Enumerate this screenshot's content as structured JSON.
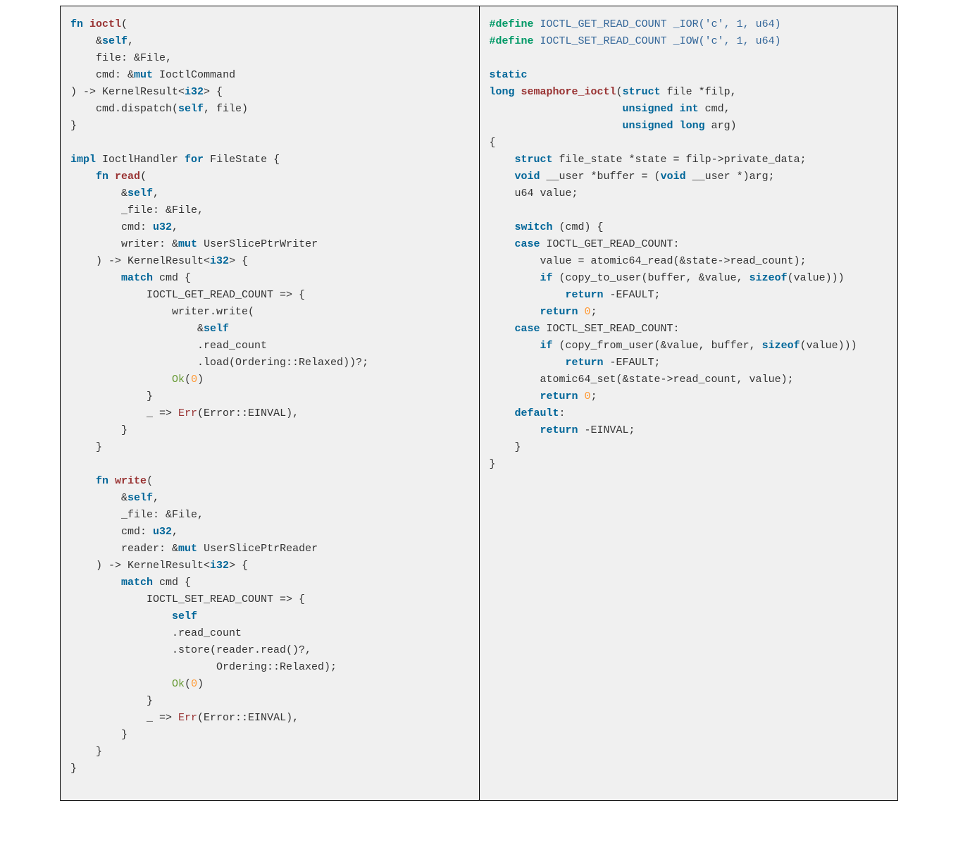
{
  "left": {
    "lang": "rust",
    "tokens": [
      [
        "kw",
        "fn"
      ],
      [
        "p",
        " "
      ],
      [
        "fnname",
        "ioctl"
      ],
      [
        "p",
        "("
      ],
      [
        "nl"
      ],
      [
        "p",
        "    "
      ],
      [
        "p",
        "&"
      ],
      [
        "kw",
        "self"
      ],
      [
        "p",
        ","
      ],
      [
        "nl"
      ],
      [
        "p",
        "    file: "
      ],
      [
        "p",
        "&File,"
      ],
      [
        "nl"
      ],
      [
        "p",
        "    cmd: "
      ],
      [
        "p",
        "&"
      ],
      [
        "kw",
        "mut"
      ],
      [
        "p",
        " IoctlCommand"
      ],
      [
        "nl"
      ],
      [
        "p",
        ") -> KernelResult<"
      ],
      [
        "ty",
        "i32"
      ],
      [
        "p",
        "> {"
      ],
      [
        "nl"
      ],
      [
        "p",
        "    cmd.dispatch("
      ],
      [
        "kw",
        "self"
      ],
      [
        "p",
        ", file)"
      ],
      [
        "nl"
      ],
      [
        "p",
        "}"
      ],
      [
        "nl"
      ],
      [
        "nl"
      ],
      [
        "kw",
        "impl"
      ],
      [
        "p",
        " IoctlHandler "
      ],
      [
        "kw",
        "for"
      ],
      [
        "p",
        " FileState {"
      ],
      [
        "nl"
      ],
      [
        "p",
        "    "
      ],
      [
        "kw",
        "fn"
      ],
      [
        "p",
        " "
      ],
      [
        "fnname",
        "read"
      ],
      [
        "p",
        "("
      ],
      [
        "nl"
      ],
      [
        "p",
        "        "
      ],
      [
        "p",
        "&"
      ],
      [
        "kw",
        "self"
      ],
      [
        "p",
        ","
      ],
      [
        "nl"
      ],
      [
        "p",
        "        _file: "
      ],
      [
        "p",
        "&File,"
      ],
      [
        "nl"
      ],
      [
        "p",
        "        cmd: "
      ],
      [
        "ty",
        "u32"
      ],
      [
        "p",
        ","
      ],
      [
        "nl"
      ],
      [
        "p",
        "        writer: "
      ],
      [
        "p",
        "&"
      ],
      [
        "kw",
        "mut"
      ],
      [
        "p",
        " UserSlicePtrWriter"
      ],
      [
        "nl"
      ],
      [
        "p",
        "    ) -> KernelResult<"
      ],
      [
        "ty",
        "i32"
      ],
      [
        "p",
        "> {"
      ],
      [
        "nl"
      ],
      [
        "p",
        "        "
      ],
      [
        "kw",
        "match"
      ],
      [
        "p",
        " cmd {"
      ],
      [
        "nl"
      ],
      [
        "p",
        "            IOCTL_GET_READ_COUNT => {"
      ],
      [
        "nl"
      ],
      [
        "p",
        "                writer.write("
      ],
      [
        "nl"
      ],
      [
        "p",
        "                    &"
      ],
      [
        "kw",
        "self"
      ],
      [
        "nl"
      ],
      [
        "p",
        "                    .read_count"
      ],
      [
        "nl"
      ],
      [
        "p",
        "                    .load(Ordering::Relaxed))?;"
      ],
      [
        "nl"
      ],
      [
        "p",
        "                "
      ],
      [
        "ok",
        "Ok"
      ],
      [
        "p",
        "("
      ],
      [
        "n",
        "0"
      ],
      [
        "p",
        ")"
      ],
      [
        "nl"
      ],
      [
        "p",
        "            }"
      ],
      [
        "nl"
      ],
      [
        "p",
        "            _ => "
      ],
      [
        "err",
        "Err"
      ],
      [
        "p",
        "(Error::EINVAL),"
      ],
      [
        "nl"
      ],
      [
        "p",
        "        }"
      ],
      [
        "nl"
      ],
      [
        "p",
        "    }"
      ],
      [
        "nl"
      ],
      [
        "nl"
      ],
      [
        "p",
        "    "
      ],
      [
        "kw",
        "fn"
      ],
      [
        "p",
        " "
      ],
      [
        "fnname",
        "write"
      ],
      [
        "p",
        "("
      ],
      [
        "nl"
      ],
      [
        "p",
        "        "
      ],
      [
        "p",
        "&"
      ],
      [
        "kw",
        "self"
      ],
      [
        "p",
        ","
      ],
      [
        "nl"
      ],
      [
        "p",
        "        _file: "
      ],
      [
        "p",
        "&File,"
      ],
      [
        "nl"
      ],
      [
        "p",
        "        cmd: "
      ],
      [
        "ty",
        "u32"
      ],
      [
        "p",
        ","
      ],
      [
        "nl"
      ],
      [
        "p",
        "        reader: "
      ],
      [
        "p",
        "&"
      ],
      [
        "kw",
        "mut"
      ],
      [
        "p",
        " UserSlicePtrReader"
      ],
      [
        "nl"
      ],
      [
        "p",
        "    ) -> KernelResult<"
      ],
      [
        "ty",
        "i32"
      ],
      [
        "p",
        "> {"
      ],
      [
        "nl"
      ],
      [
        "p",
        "        "
      ],
      [
        "kw",
        "match"
      ],
      [
        "p",
        " cmd {"
      ],
      [
        "nl"
      ],
      [
        "p",
        "            IOCTL_SET_READ_COUNT => {"
      ],
      [
        "nl"
      ],
      [
        "p",
        "                "
      ],
      [
        "kw",
        "self"
      ],
      [
        "nl"
      ],
      [
        "p",
        "                .read_count"
      ],
      [
        "nl"
      ],
      [
        "p",
        "                .store(reader.read()?,"
      ],
      [
        "nl"
      ],
      [
        "p",
        "                       Ordering::Relaxed);"
      ],
      [
        "nl"
      ],
      [
        "p",
        "                "
      ],
      [
        "ok",
        "Ok"
      ],
      [
        "p",
        "("
      ],
      [
        "n",
        "0"
      ],
      [
        "p",
        ")"
      ],
      [
        "nl"
      ],
      [
        "p",
        "            }"
      ],
      [
        "nl"
      ],
      [
        "p",
        "            _ => "
      ],
      [
        "err",
        "Err"
      ],
      [
        "p",
        "(Error::EINVAL),"
      ],
      [
        "nl"
      ],
      [
        "p",
        "        }"
      ],
      [
        "nl"
      ],
      [
        "p",
        "    }"
      ],
      [
        "nl"
      ],
      [
        "p",
        "}"
      ],
      [
        "nl"
      ]
    ]
  },
  "right": {
    "lang": "c",
    "tokens": [
      [
        "pre",
        "#"
      ],
      [
        "pre",
        "define"
      ],
      [
        "p",
        " "
      ],
      [
        "m",
        "IOCTL_GET_READ_COUNT _IOR('c', 1, u64)"
      ],
      [
        "nl"
      ],
      [
        "pre",
        "#"
      ],
      [
        "pre",
        "define"
      ],
      [
        "p",
        " "
      ],
      [
        "m",
        "IOCTL_SET_READ_COUNT _IOW('c', 1, u64)"
      ],
      [
        "nl"
      ],
      [
        "nl"
      ],
      [
        "kw",
        "static"
      ],
      [
        "nl"
      ],
      [
        "kw",
        "long"
      ],
      [
        "p",
        " "
      ],
      [
        "fnname",
        "semaphore_ioctl"
      ],
      [
        "p",
        "("
      ],
      [
        "kw",
        "struct"
      ],
      [
        "p",
        " file *filp,"
      ],
      [
        "nl"
      ],
      [
        "p",
        "                     "
      ],
      [
        "kw",
        "unsigned"
      ],
      [
        "p",
        " "
      ],
      [
        "kw",
        "int"
      ],
      [
        "p",
        " cmd,"
      ],
      [
        "nl"
      ],
      [
        "p",
        "                     "
      ],
      [
        "kw",
        "unsigned"
      ],
      [
        "p",
        " "
      ],
      [
        "kw",
        "long"
      ],
      [
        "p",
        " arg)"
      ],
      [
        "nl"
      ],
      [
        "p",
        "{"
      ],
      [
        "nl"
      ],
      [
        "p",
        "    "
      ],
      [
        "kw",
        "struct"
      ],
      [
        "p",
        " file_state *state = filp->private_data;"
      ],
      [
        "nl"
      ],
      [
        "p",
        "    "
      ],
      [
        "kw",
        "void"
      ],
      [
        "p",
        " __user *buffer = ("
      ],
      [
        "kw",
        "void"
      ],
      [
        "p",
        " __user *)arg;"
      ],
      [
        "nl"
      ],
      [
        "p",
        "    u64 value;"
      ],
      [
        "nl"
      ],
      [
        "nl"
      ],
      [
        "p",
        "    "
      ],
      [
        "kw",
        "switch"
      ],
      [
        "p",
        " (cmd) {"
      ],
      [
        "nl"
      ],
      [
        "p",
        "    "
      ],
      [
        "kw",
        "case"
      ],
      [
        "p",
        " IOCTL_GET_READ_COUNT:"
      ],
      [
        "nl"
      ],
      [
        "p",
        "        value = atomic64_read(&state->read_count);"
      ],
      [
        "nl"
      ],
      [
        "p",
        "        "
      ],
      [
        "kw",
        "if"
      ],
      [
        "p",
        " (copy_to_user(buffer, &value, "
      ],
      [
        "kw",
        "sizeof"
      ],
      [
        "p",
        "(value)))"
      ],
      [
        "nl"
      ],
      [
        "p",
        "            "
      ],
      [
        "kw",
        "return"
      ],
      [
        "p",
        " -EFAULT;"
      ],
      [
        "nl"
      ],
      [
        "p",
        "        "
      ],
      [
        "kw",
        "return"
      ],
      [
        "p",
        " "
      ],
      [
        "n",
        "0"
      ],
      [
        "p",
        ";"
      ],
      [
        "nl"
      ],
      [
        "p",
        "    "
      ],
      [
        "kw",
        "case"
      ],
      [
        "p",
        " IOCTL_SET_READ_COUNT:"
      ],
      [
        "nl"
      ],
      [
        "p",
        "        "
      ],
      [
        "kw",
        "if"
      ],
      [
        "p",
        " (copy_from_user(&value, buffer, "
      ],
      [
        "kw",
        "sizeof"
      ],
      [
        "p",
        "(value)))"
      ],
      [
        "nl"
      ],
      [
        "p",
        "            "
      ],
      [
        "kw",
        "return"
      ],
      [
        "p",
        " -EFAULT;"
      ],
      [
        "nl"
      ],
      [
        "p",
        "        atomic64_set(&state->read_count, value);"
      ],
      [
        "nl"
      ],
      [
        "p",
        "        "
      ],
      [
        "kw",
        "return"
      ],
      [
        "p",
        " "
      ],
      [
        "n",
        "0"
      ],
      [
        "p",
        ";"
      ],
      [
        "nl"
      ],
      [
        "p",
        "    "
      ],
      [
        "kw",
        "default"
      ],
      [
        "p",
        ":"
      ],
      [
        "nl"
      ],
      [
        "p",
        "        "
      ],
      [
        "kw",
        "return"
      ],
      [
        "p",
        " -EINVAL;"
      ],
      [
        "nl"
      ],
      [
        "p",
        "    }"
      ],
      [
        "nl"
      ],
      [
        "p",
        "}"
      ],
      [
        "nl"
      ]
    ]
  }
}
